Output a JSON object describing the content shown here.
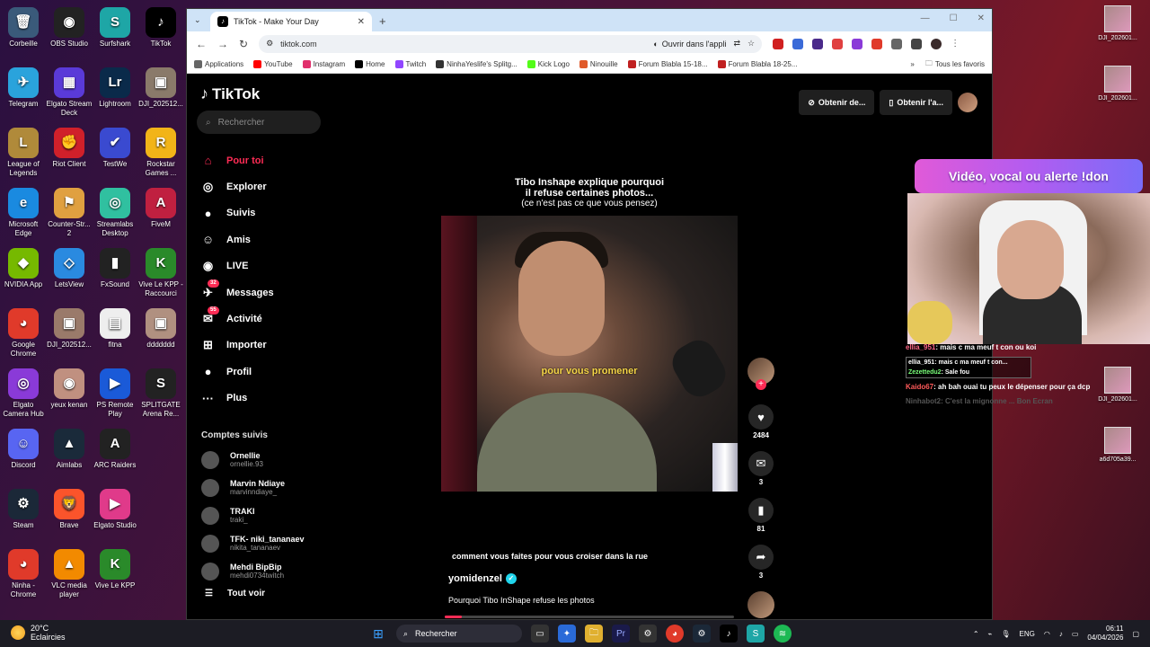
{
  "desktop": {
    "icons_left": [
      {
        "label": "Corbeille",
        "col": 0,
        "row": 0,
        "glyph": "🗑",
        "color": "#3a5a7a"
      },
      {
        "label": "OBS Studio",
        "col": 1,
        "row": 0,
        "glyph": "◉",
        "color": "#222"
      },
      {
        "label": "Surfshark",
        "col": 2,
        "row": 0,
        "glyph": "S",
        "color": "#1ea6a6"
      },
      {
        "label": "TikTok",
        "col": 3,
        "row": 0,
        "glyph": "♪",
        "color": "#000"
      },
      {
        "label": "Telegram",
        "col": 0,
        "row": 1,
        "glyph": "✈",
        "color": "#2aa3dc"
      },
      {
        "label": "Elgato Stream Deck",
        "col": 1,
        "row": 1,
        "glyph": "▦",
        "color": "#5a3ad8"
      },
      {
        "label": "Lightroom",
        "col": 2,
        "row": 1,
        "glyph": "Lr",
        "color": "#0a2a4a"
      },
      {
        "label": "DJI_202512...",
        "col": 3,
        "row": 1,
        "glyph": "▣",
        "color": "#8a7a6a"
      },
      {
        "label": "League of Legends",
        "col": 0,
        "row": 2,
        "glyph": "L",
        "color": "#b08a3a"
      },
      {
        "label": "Riot Client",
        "col": 1,
        "row": 2,
        "glyph": "✊",
        "color": "#d0202a"
      },
      {
        "label": "TestWe",
        "col": 2,
        "row": 2,
        "glyph": "✔",
        "color": "#3a4ad0"
      },
      {
        "label": "Rockstar Games ...",
        "col": 3,
        "row": 2,
        "glyph": "R",
        "color": "#f2b418"
      },
      {
        "label": "Microsoft Edge",
        "col": 0,
        "row": 3,
        "glyph": "e",
        "color": "#1a8ae0"
      },
      {
        "label": "Counter-Str... 2",
        "col": 1,
        "row": 3,
        "glyph": "⚑",
        "color": "#e0a040"
      },
      {
        "label": "Streamlabs Desktop",
        "col": 2,
        "row": 3,
        "glyph": "◎",
        "color": "#30c0a0"
      },
      {
        "label": "FiveM",
        "col": 3,
        "row": 3,
        "glyph": "A",
        "color": "#c02040"
      },
      {
        "label": "NVIDIA App",
        "col": 0,
        "row": 4,
        "glyph": "◆",
        "color": "#76b900"
      },
      {
        "label": "LetsView",
        "col": 1,
        "row": 4,
        "glyph": "◇",
        "color": "#2a8ae0"
      },
      {
        "label": "FxSound",
        "col": 2,
        "row": 4,
        "glyph": "▮",
        "color": "#222"
      },
      {
        "label": "Vive Le KPP - Raccourci",
        "col": 3,
        "row": 4,
        "glyph": "K",
        "color": "#2a8a2a"
      },
      {
        "label": "Google Chrome",
        "col": 0,
        "row": 5,
        "glyph": "◕",
        "color": "#e03a2a"
      },
      {
        "label": "DJI_202512...",
        "col": 1,
        "row": 5,
        "glyph": "▣",
        "color": "#9a7a6a"
      },
      {
        "label": "fitna",
        "col": 2,
        "row": 5,
        "glyph": "▤",
        "color": "#eeeeee"
      },
      {
        "label": "ddddddd",
        "col": 3,
        "row": 5,
        "glyph": "▣",
        "color": "#b09080"
      },
      {
        "label": "Elgato Camera Hub",
        "col": 0,
        "row": 6,
        "glyph": "◎",
        "color": "#8a3ad8"
      },
      {
        "label": "yeux kenan",
        "col": 1,
        "row": 6,
        "glyph": "◉",
        "color": "#c09080"
      },
      {
        "label": "PS Remote Play",
        "col": 2,
        "row": 6,
        "glyph": "▶",
        "color": "#1a5ad8"
      },
      {
        "label": "SPLITGATE Arena Re...",
        "col": 3,
        "row": 6,
        "glyph": "S",
        "color": "#222"
      },
      {
        "label": "Discord",
        "col": 0,
        "row": 7,
        "glyph": "☺",
        "color": "#5865f2"
      },
      {
        "label": "Aimlabs",
        "col": 1,
        "row": 7,
        "glyph": "▲",
        "color": "#1a2a3a"
      },
      {
        "label": "ARC Raiders",
        "col": 2,
        "row": 7,
        "glyph": "A",
        "color": "#222"
      },
      {
        "label": "Steam",
        "col": 0,
        "row": 8,
        "glyph": "⚙",
        "color": "#1b2838"
      },
      {
        "label": "Brave",
        "col": 1,
        "row": 8,
        "glyph": "🦁",
        "color": "#fb542b"
      },
      {
        "label": "Elgato Studio",
        "col": 2,
        "row": 8,
        "glyph": "▶",
        "color": "#e03a8a"
      },
      {
        "label": "Ninha - Chrome",
        "col": 0,
        "row": 9,
        "glyph": "◕",
        "color": "#e03a2a"
      },
      {
        "label": "VLC media player",
        "col": 1,
        "row": 9,
        "glyph": "▲",
        "color": "#f28a00"
      },
      {
        "label": "Vive Le KPP",
        "col": 2,
        "row": 9,
        "glyph": "K",
        "color": "#2a8a2a"
      }
    ],
    "icons_right": [
      {
        "label": "DJI_202601...",
        "row": 0
      },
      {
        "label": "DJI_202601...",
        "row": 1
      },
      {
        "label": "DJI_202601...",
        "row": 6
      },
      {
        "label": "a6d705a39...",
        "row": 7
      }
    ],
    "top_banner": "573580"
  },
  "browser": {
    "tab_title": "TikTok - Make Your Day",
    "url": "tiktok.com",
    "open_app_label": "Ouvrir dans l'appli",
    "bookmarks": [
      {
        "label": "Applications",
        "color": "#666"
      },
      {
        "label": "YouTube",
        "color": "#ff0000"
      },
      {
        "label": "Instagram",
        "color": "#e1306c"
      },
      {
        "label": "Home",
        "color": "#000"
      },
      {
        "label": "Twitch",
        "color": "#9146ff"
      },
      {
        "label": "NinhaYeslife's Splitg...",
        "color": "#333"
      },
      {
        "label": "Kick Logo",
        "color": "#53fc18"
      },
      {
        "label": "Ninouille",
        "color": "#e05a2a"
      },
      {
        "label": "Forum Blabla 15-18...",
        "color": "#c02020"
      },
      {
        "label": "Forum Blabla 18-25...",
        "color": "#c02020"
      }
    ],
    "all_bookmarks_label": "Tous les favoris"
  },
  "tiktok": {
    "logo": "TikTok",
    "search_placeholder": "Rechercher",
    "nav": [
      {
        "label": "Pour toi",
        "icon": "⌂",
        "active": true,
        "badge": ""
      },
      {
        "label": "Explorer",
        "icon": "◎",
        "active": false,
        "badge": ""
      },
      {
        "label": "Suivis",
        "icon": "●",
        "active": false,
        "badge": ""
      },
      {
        "label": "Amis",
        "icon": "☺",
        "active": false,
        "badge": ""
      },
      {
        "label": "LIVE",
        "icon": "◉",
        "active": false,
        "badge": ""
      },
      {
        "label": "Messages",
        "icon": "✈",
        "active": false,
        "badge": "32"
      },
      {
        "label": "Activité",
        "icon": "✉",
        "active": false,
        "badge": "55"
      },
      {
        "label": "Importer",
        "icon": "⊞",
        "active": false,
        "badge": ""
      },
      {
        "label": "Profil",
        "icon": "●",
        "active": false,
        "badge": ""
      },
      {
        "label": "Plus",
        "icon": "···",
        "active": false,
        "badge": ""
      }
    ],
    "following_title": "Comptes suivis",
    "following": [
      {
        "name": "Ornellie",
        "handle": "ornellie.93"
      },
      {
        "name": "Marvin Ndiaye",
        "handle": "marvinndiaye_"
      },
      {
        "name": "TRAKI",
        "handle": "traki_"
      },
      {
        "name": "TFK- niki_tananaev",
        "handle": "nikita_tananaev"
      },
      {
        "name": "Mehdi BipBip",
        "handle": "mehdi0734twitch"
      }
    ],
    "see_all": "Tout voir",
    "top_buttons": [
      "Obtenir de...",
      "Obtenir l'a..."
    ],
    "video": {
      "title_line1": "Tibo Inshape explique pourquoi",
      "title_line2": "il refuse certaines photos...",
      "title_line3": "(ce n'est pas ce que vous pensez)",
      "subtitle": "pour vous promener",
      "caption": "comment vous faites pour vous croiser dans la rue",
      "author": "yomidenzel",
      "description": "Pourquoi Tibo InShape refuse les photos",
      "progress_percent": 6
    },
    "actions": {
      "likes": "2484",
      "comments": "3",
      "saves": "81",
      "shares": "3"
    }
  },
  "stream": {
    "donation_banner": "Vidéo, vocal ou alerte !don",
    "chat": [
      {
        "user": "ellia_951",
        "msg": "mais c ma meuf t con ou koi",
        "style": "cut"
      },
      {
        "user": "ellia_951",
        "msg": "mais c ma meuf t con...",
        "user2": "Zezettedu2",
        "msg2": "Sale fou",
        "style": "boxed"
      },
      {
        "user": "Kaido67",
        "msg": "ah bah ouai tu peux le dépenser pour ça dcp",
        "style": "normal"
      },
      {
        "user": "Ninhabot2",
        "msg": "C'est la mignonne ... Bon Ecran",
        "style": "faded"
      }
    ]
  },
  "taskbar": {
    "temperature": "20°C",
    "weather": "Eclaircies",
    "search_label": "Rechercher",
    "lang": "ENG",
    "time": "06:11",
    "date": "04/04/2026"
  }
}
